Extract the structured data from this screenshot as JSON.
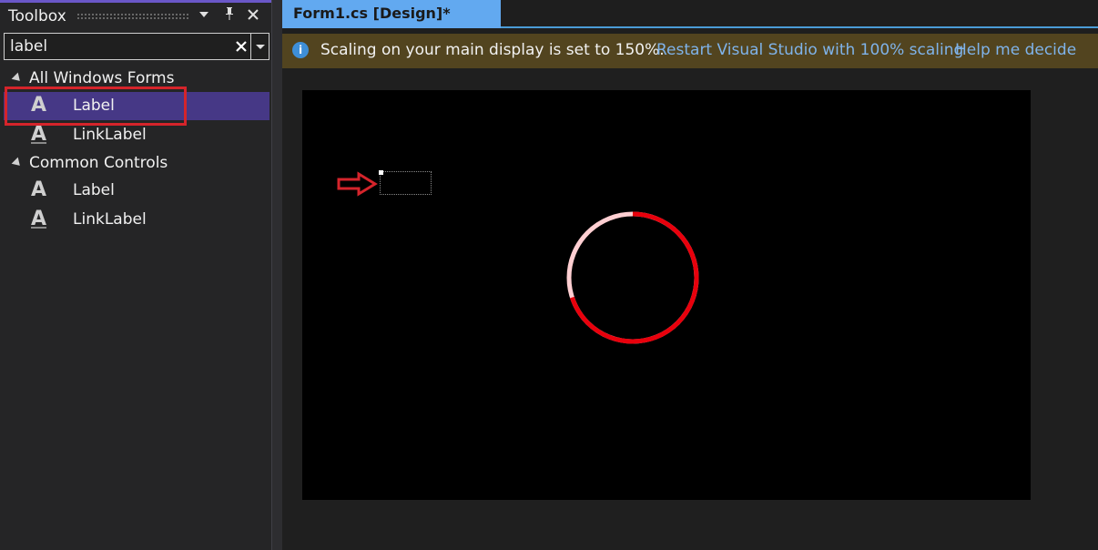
{
  "toolbox": {
    "title": "Toolbox",
    "buttons": {
      "dropdown": "▼",
      "pin": "📌",
      "close": "✕"
    },
    "search": {
      "value": "label",
      "placeholder": ""
    },
    "groups": [
      {
        "label": "All Windows Forms",
        "items": [
          {
            "label": "Label",
            "icon": "label-icon",
            "selected": true
          },
          {
            "label": "LinkLabel",
            "icon": "link-label-icon",
            "selected": false
          }
        ]
      },
      {
        "label": "Common Controls",
        "items": [
          {
            "label": "Label",
            "icon": "label-icon",
            "selected": false
          },
          {
            "label": "LinkLabel",
            "icon": "link-label-icon",
            "selected": false
          }
        ]
      }
    ]
  },
  "document": {
    "tab_label": "Form1.cs [Design]*"
  },
  "infobar": {
    "message": "Scaling on your main display is set to 150%.",
    "restart_link": "Restart Visual Studio with 100% scaling",
    "help_link": "Help me decide"
  },
  "colors": {
    "accent_purple": "#463886",
    "highlight_red": "#d5242b",
    "tab_blue": "#62a9f0",
    "infobar_bg": "#52441f",
    "link_blue": "#7fb3ea",
    "spinner_red": "#e8000c",
    "spinner_track": "#ffcfd2"
  }
}
